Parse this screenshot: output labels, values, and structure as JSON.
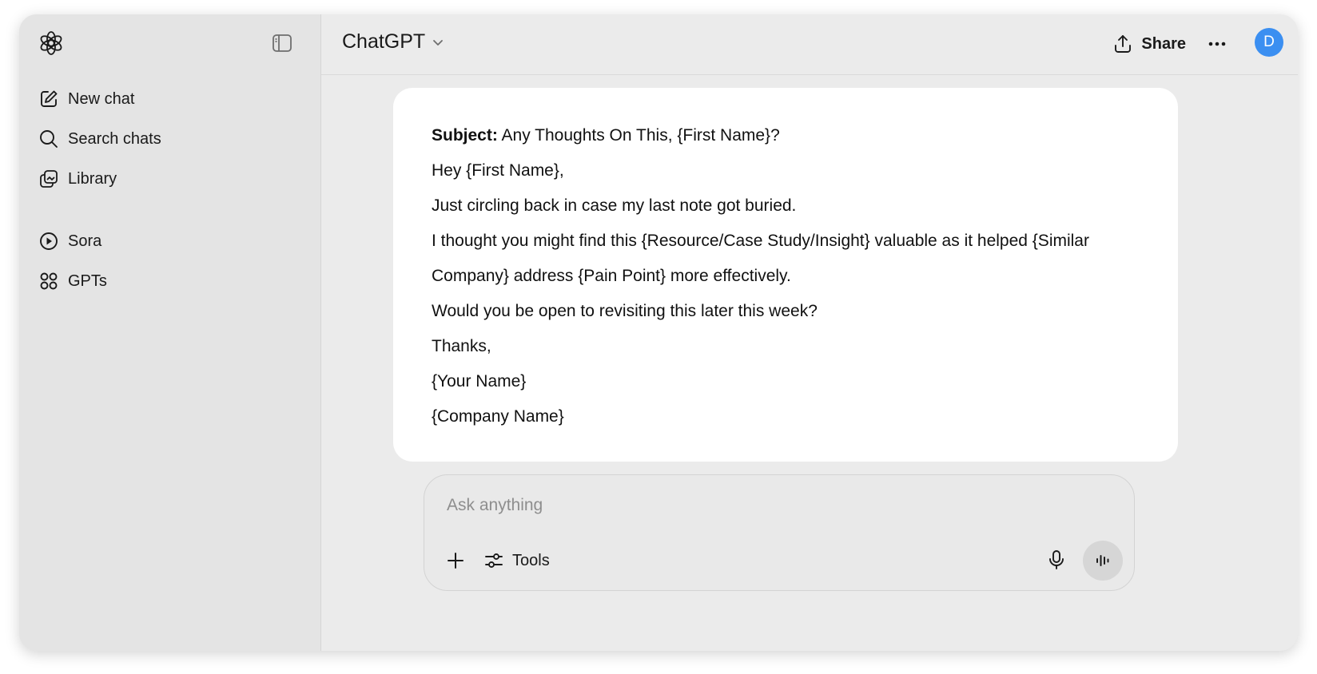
{
  "sidebar": {
    "logo_icon": "openai-logo-icon",
    "toggle_icon": "sidebar-toggle-icon",
    "items": [
      {
        "label": "New chat",
        "icon": "edit-icon"
      },
      {
        "label": "Search chats",
        "icon": "search-icon"
      },
      {
        "label": "Library",
        "icon": "library-icon"
      },
      {
        "label": "Sora",
        "icon": "play-icon"
      },
      {
        "label": "GPTs",
        "icon": "grid-icon"
      }
    ]
  },
  "header": {
    "model_name": "ChatGPT",
    "share_label": "Share",
    "avatar_initial": "D",
    "avatar_color": "#3b8ff1"
  },
  "message": {
    "subject_label": "Subject:",
    "subject_text": " Any Thoughts On This, {First Name}?",
    "lines": [
      "Hey {First Name},",
      "Just circling back in case my last note got buried.",
      "I thought you might find this {Resource/Case Study/Insight} valuable as it helped {Similar",
      "Company} address {Pain Point} more effectively.",
      "Would you be open to revisiting this later this week?",
      "Thanks,",
      "{Your Name}",
      "{Company Name}"
    ]
  },
  "composer": {
    "placeholder": "Ask anything",
    "tools_label": "Tools"
  }
}
